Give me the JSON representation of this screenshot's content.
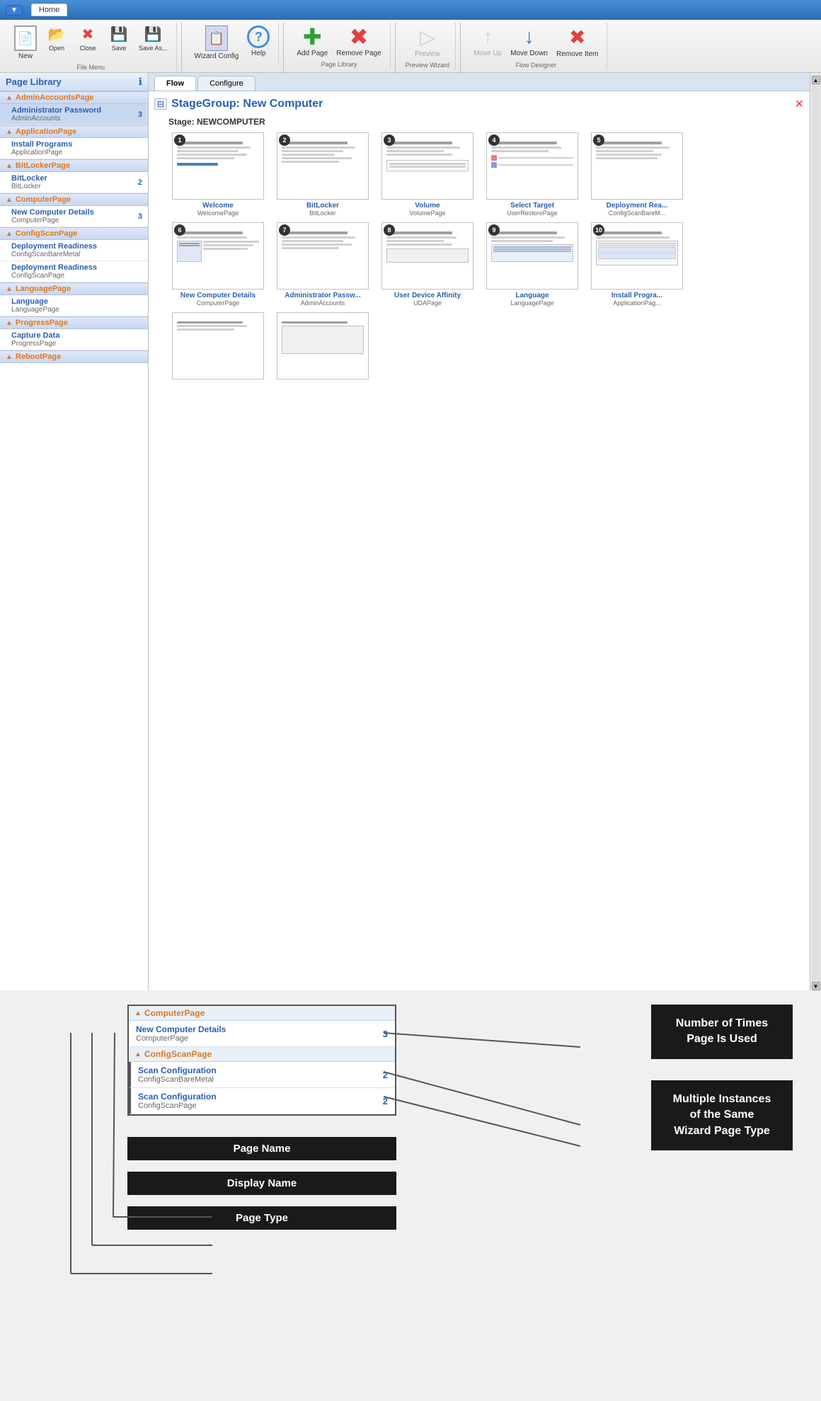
{
  "titlebar": {
    "home_tab": "Home",
    "app_btn": "▼"
  },
  "ribbon": {
    "groups": [
      {
        "label": "File Menu",
        "items": [
          {
            "id": "new",
            "label": "New",
            "icon": "📄",
            "disabled": false
          },
          {
            "id": "open",
            "label": "Open",
            "icon": "📂",
            "disabled": false
          },
          {
            "id": "close",
            "label": "Close",
            "icon": "✕",
            "disabled": false
          },
          {
            "id": "save",
            "label": "Save",
            "icon": "💾",
            "disabled": false
          },
          {
            "id": "saveas",
            "label": "Save As...",
            "icon": "💾",
            "disabled": false
          }
        ]
      },
      {
        "label": "",
        "items": [
          {
            "id": "wizard",
            "label": "Wizard Config",
            "icon": "🔧",
            "disabled": false
          },
          {
            "id": "help",
            "label": "Help",
            "icon": "?",
            "disabled": false
          }
        ]
      },
      {
        "label": "Page Library",
        "items": [
          {
            "id": "addpage",
            "label": "Add Page",
            "icon": "+",
            "disabled": false
          },
          {
            "id": "removepage",
            "label": "Remove Page",
            "icon": "✕",
            "disabled": false
          }
        ]
      },
      {
        "label": "Preview Wizard",
        "items": [
          {
            "id": "preview",
            "label": "Preview",
            "icon": "▷",
            "disabled": true
          }
        ]
      },
      {
        "label": "Flow Designer",
        "items": [
          {
            "id": "moveup",
            "label": "Move Up",
            "icon": "↑",
            "disabled": true
          },
          {
            "id": "movedown",
            "label": "Move Down",
            "icon": "↓",
            "disabled": false
          },
          {
            "id": "removeitem",
            "label": "Remove Item",
            "icon": "✕",
            "disabled": false
          }
        ]
      }
    ]
  },
  "sidebar": {
    "title": "Page Library",
    "sections": [
      {
        "id": "AdminAccountsPage",
        "title": "AdminAccountsPage",
        "items": [
          {
            "name": "Administrator Password",
            "type": "AdminAccounts",
            "count": 3,
            "selected": true
          }
        ]
      },
      {
        "id": "ApplicationPage",
        "title": "ApplicationPage",
        "items": [
          {
            "name": "Install Programs",
            "type": "ApplicationPage",
            "count": null,
            "selected": false
          }
        ]
      },
      {
        "id": "BitLockerPage",
        "title": "BitLockerPage",
        "items": [
          {
            "name": "BitLocker",
            "type": "BitLocker",
            "count": 2,
            "selected": false
          }
        ]
      },
      {
        "id": "ComputerPage",
        "title": "ComputerPage",
        "items": [
          {
            "name": "New Computer Details",
            "type": "ComputerPage",
            "count": 3,
            "selected": false
          }
        ]
      },
      {
        "id": "ConfigScanPage",
        "title": "ConfigScanPage",
        "items": [
          {
            "name": "Deployment Readiness",
            "type": "ConfigScanBareMetal",
            "count": null,
            "selected": false
          },
          {
            "name": "Deployment Readiness",
            "type": "ConfigScanPage",
            "count": null,
            "selected": false
          }
        ]
      },
      {
        "id": "LanguagePage",
        "title": "LanguagePage",
        "items": [
          {
            "name": "Language",
            "type": "LanguagePage",
            "count": null,
            "selected": false
          }
        ]
      },
      {
        "id": "ProgressPage",
        "title": "ProgressPage",
        "items": [
          {
            "name": "Capture Data",
            "type": "ProgressPage",
            "count": null,
            "selected": false
          }
        ]
      },
      {
        "id": "RebootPage",
        "title": "RebootPage",
        "items": []
      }
    ]
  },
  "tabs": [
    {
      "id": "flow",
      "label": "Flow",
      "active": true
    },
    {
      "id": "configure",
      "label": "Configure",
      "active": false
    }
  ],
  "flow": {
    "stage_group": "StageGroup: New Computer",
    "stage_label": "Stage: NEWCOMPUTER",
    "pages_row1": [
      {
        "number": "1",
        "name": "Welcome",
        "type": "WelcomePage"
      },
      {
        "number": "2",
        "name": "BitLocker",
        "type": "BitLocker"
      },
      {
        "number": "3",
        "name": "Volume",
        "type": "VolumePage"
      },
      {
        "number": "4",
        "name": "Select Target",
        "type": "UserRestorePage"
      },
      {
        "number": "5",
        "name": "Deployment Rea...",
        "type": "ConfigScanBareM..."
      }
    ],
    "pages_row2": [
      {
        "number": "6",
        "name": "New Computer Details",
        "type": "ComputerPage"
      },
      {
        "number": "7",
        "name": "Administrator Passw...",
        "type": "AdminAccounts"
      },
      {
        "number": "8",
        "name": "User Device Affinity",
        "type": "UDAPage"
      },
      {
        "number": "9",
        "name": "Language",
        "type": "LanguagePage"
      },
      {
        "number": "10",
        "name": "Install Progra...",
        "type": "ApplicationPag..."
      }
    ]
  },
  "callout": {
    "sections": [
      {
        "title": "ComputerPage",
        "items": [
          {
            "name": "New Computer Details",
            "type": "ComputerPage",
            "count": "3"
          }
        ]
      },
      {
        "title": "ConfigScanPage",
        "items": [
          {
            "name": "Scan Configuration",
            "type": "ConfigScanBareMetal",
            "count": "2"
          },
          {
            "name": "Scan Configuration",
            "type": "ConfigScanPage",
            "count": "2"
          }
        ]
      }
    ]
  },
  "annotations": {
    "number_of_times": "Number of Times Page Is Used",
    "multiple_instances": "Multiple Instances\nof the Same\nWizard Page Type",
    "page_name": "Page Name",
    "display_name": "Display Name",
    "page_type": "Page Type"
  }
}
